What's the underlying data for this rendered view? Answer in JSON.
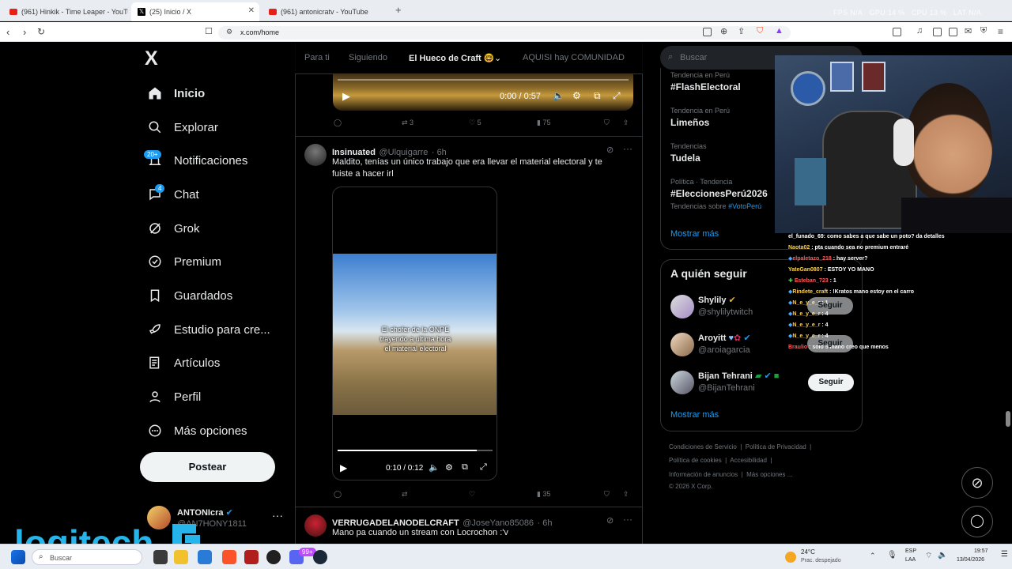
{
  "browser": {
    "tabs": [
      {
        "label": "(961) Hinkik - Time Leaper - YouTube",
        "type": "youtube"
      },
      {
        "label": "(25) Inicio / X",
        "type": "x",
        "active": true
      },
      {
        "label": "(961) antonicratv - YouTube",
        "type": "youtube"
      }
    ],
    "new_tab": "+",
    "perf_overlay": {
      "fps_label": "FPS",
      "fps_value": "N/A",
      "gpu_label": "GPU",
      "gpu_value": "14 %",
      "cpu_label": "CPU",
      "cpu_value": "13 %",
      "lat_label": "LAT",
      "lat_value": "N/A"
    },
    "url": "x.com/home"
  },
  "sidebar": {
    "logo": "X",
    "items": [
      {
        "label": "Inicio",
        "icon": "home-icon",
        "selected": true
      },
      {
        "label": "Explorar",
        "icon": "search-icon"
      },
      {
        "label": "Notificaciones",
        "icon": "bell-icon",
        "badge": "20+"
      },
      {
        "label": "Chat",
        "icon": "chat-icon",
        "badge": "4"
      },
      {
        "label": "Grok",
        "icon": "grok-icon"
      },
      {
        "label": "Premium",
        "icon": "premium-icon"
      },
      {
        "label": "Guardados",
        "icon": "bookmark-icon"
      },
      {
        "label": "Estudio para cre...",
        "icon": "rocket-icon"
      },
      {
        "label": "Artículos",
        "icon": "article-icon"
      },
      {
        "label": "Perfil",
        "icon": "person-icon"
      },
      {
        "label": "Más opciones",
        "icon": "more-icon"
      }
    ],
    "post_button": "Postear",
    "account": {
      "name": "ANTONIcra",
      "handle": "@AN7HONY1811",
      "more": "···"
    }
  },
  "timeline": {
    "tabs": [
      "Para ti",
      "Siguiendo",
      "El Hueco de Craft 🤓",
      "AQUISI hay COMUNIDAD"
    ],
    "first_video": {
      "time": "0:00 / 0:57"
    },
    "first_actions": {
      "retweets": "3",
      "likes": "5",
      "views": "75"
    },
    "tweet2": {
      "name": "Insinuated",
      "handle": "@Ulquigarre",
      "time": "· 6h",
      "text_line1": "Maldito, tenías un único trabajo que era llevar el material electoral y te",
      "text_line2": "fuiste a hacer irl",
      "caption_l1": "El chofer de la ONPE",
      "caption_l2": "trayendo a ultima hora",
      "caption_l3": "el material electoral",
      "video_time": "0:10 / 0:12",
      "video_progress": 0.9,
      "views": "35"
    },
    "tweet3": {
      "name": "VERRUGADELANODELCRAFT",
      "handle": "@JoseYano85086",
      "time": "· 6h",
      "text": "Mano pa cuando un stream con Locrochon :'v"
    }
  },
  "right": {
    "search_placeholder": "Buscar",
    "trends": [
      {
        "category": "Tendencia en Perú",
        "title": "#FlashElectoral"
      },
      {
        "category": "Tendencia en Perú",
        "title": "Limeños"
      },
      {
        "category": "Tendencias",
        "title": "Tudela"
      },
      {
        "category": "Política · Tendencia",
        "title": "#EleccionesPerú2026",
        "extra_prefix": "Tendencias sobre",
        "extra_link": "#VotoPerú"
      }
    ],
    "trends_more": "Mostrar más",
    "follow_title": "A quién seguir",
    "follow": [
      {
        "name": "Shylily",
        "handle": "@shylilytwitch",
        "button": "Seguir"
      },
      {
        "name": "Aroyitt",
        "handle": "@aroiagarcia",
        "button": "Seguir"
      },
      {
        "name": "Bijan Tehrani",
        "handle": "@BijanTehrani",
        "button": "Seguir"
      }
    ],
    "follow_more": "Mostrar más",
    "footer": {
      "l1a": "Condiciones de Servicio",
      "l1b": "Política de Privacidad",
      "l2a": "Política de cookies",
      "l2b": "Accesibilidad",
      "l3a": "Información de anuncios",
      "l3b": "Más opciones ...",
      "copyright": "© 2026 X Corp."
    }
  },
  "stream_chat": [
    {
      "user": "el_funado_69",
      "color": "#ffffff",
      "msg": ": como sabes a que sabe un poto? da detalles"
    },
    {
      "user": "Naota02",
      "color": "#ffd24a",
      "msg": ": pta cuando sea no premium entraré"
    },
    {
      "user": "elpaletazo_218",
      "color": "#ff5a5a",
      "msg": ": hay server?"
    },
    {
      "user": "YateGan0807",
      "color": "#ffd24a",
      "msg": ": ESTOY YO MANO"
    },
    {
      "user": "Esteban_723",
      "color": "#ff5a5a",
      "msg": ": 1"
    },
    {
      "user": "Rindete_craft",
      "color": "#ffd24a",
      "msg": ": !Kratos   mano estoy en el carro"
    },
    {
      "user": "N_e_y_e_r",
      "color": "#ffd24a",
      "msg": ": 1"
    },
    {
      "user": "N_e_y_e_r",
      "color": "#ffd24a",
      "msg": ": 4"
    },
    {
      "user": "N_e_y_e_r",
      "color": "#ffd24a",
      "msg": ": 4"
    },
    {
      "user": "N_e_y_e_r",
      "color": "#ffd24a",
      "msg": ": 4"
    },
    {
      "user": "Braulio",
      "color": "#ff5a5a",
      "msg": ": solo 5 mano creo que menos"
    }
  ],
  "overlay_logo": "logitech G",
  "taskbar": {
    "search": "Buscar",
    "weather_temp": "24°C",
    "weather_text": "Prac. despejado",
    "lang1": "ESP",
    "lang2": "LAA",
    "time": "19:57",
    "date": "13/04/2026",
    "steam_badge": "99+"
  }
}
